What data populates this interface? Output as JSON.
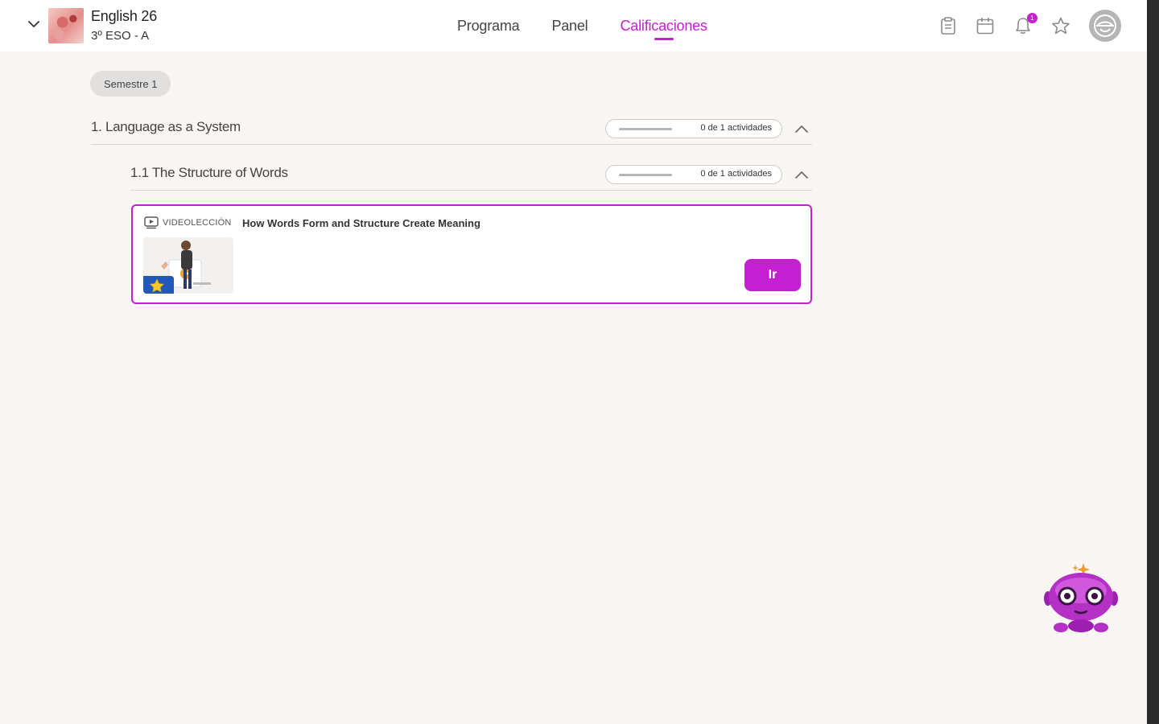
{
  "header": {
    "course_name": "English 26",
    "course_group": "3º ESO - A",
    "tabs": [
      {
        "label": "Programa",
        "active": false
      },
      {
        "label": "Panel",
        "active": false
      },
      {
        "label": "Calificaciones",
        "active": true
      }
    ],
    "notification_count": "1",
    "icons": [
      "chevron-down-icon",
      "clipboard-icon",
      "calendar-icon",
      "bell-icon",
      "star-icon",
      "avatar-icon"
    ]
  },
  "semester": {
    "label": "Semestre 1"
  },
  "sections": [
    {
      "title": "1. Language as a System",
      "progress_text": "0 de 1 actividades",
      "progress_fraction": 0
    }
  ],
  "subsections": [
    {
      "title": "1.1 The Structure of Words",
      "progress_text": "0 de 1 actividades",
      "progress_fraction": 0
    }
  ],
  "activity": {
    "type_label": "VIDEOLECCIÓN",
    "title": "How Words Form and Structure Create Meaning",
    "button_label": "Ir"
  },
  "colors": {
    "accent": "#c41fd1",
    "background": "#f9f6f4",
    "header": "#ffffff"
  }
}
